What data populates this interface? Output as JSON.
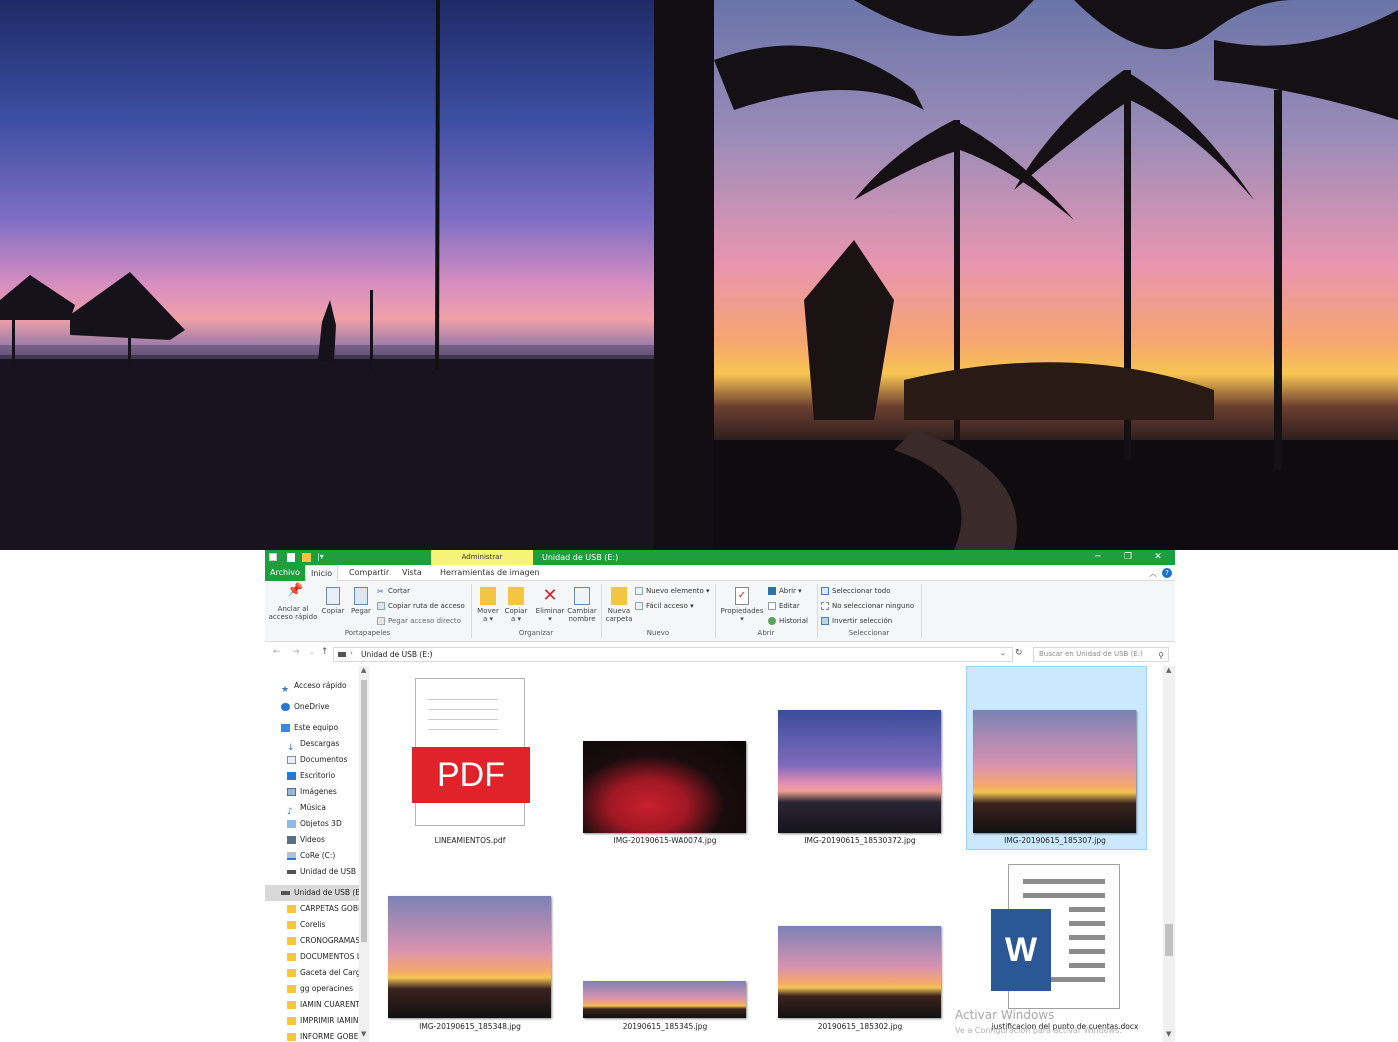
{
  "window": {
    "title": "Unidad de USB (E:)",
    "context_tab": "Administrar"
  },
  "tabs": [
    "Archivo",
    "Inicio",
    "Compartir",
    "Vista",
    "Herramientas de imagen"
  ],
  "ribbon": {
    "portapapeles": {
      "anclar": "Anclar al",
      "anclar2": "acceso rápido",
      "copiar": "Copiar",
      "pegar": "Pegar",
      "cortar": "Cortar",
      "copiar_ruta": "Copiar ruta de acceso",
      "pegar_acceso": "Pegar acceso directo",
      "label": "Portapapeles"
    },
    "organizar": {
      "mover": "Mover",
      "mover2": "a ▾",
      "copiar": "Copiar",
      "copiar2": "a ▾",
      "eliminar": "Eliminar",
      "eliminar2": "▾",
      "cambiar": "Cambiar",
      "cambiar2": "nombre",
      "label": "Organizar"
    },
    "nuevo": {
      "nueva": "Nueva",
      "nueva2": "carpeta",
      "nuevo_elemento": "Nuevo elemento ▾",
      "facil_acceso": "Fácil acceso ▾",
      "label": "Nuevo"
    },
    "abrir": {
      "propiedades": "Propiedades",
      "propiedades2": "▾",
      "abrir": "Abrir ▾",
      "editar": "Editar",
      "historial": "Historial",
      "label": "Abrir"
    },
    "seleccionar": {
      "todo": "Seleccionar todo",
      "ninguno": "No seleccionar ninguno",
      "invertir": "Invertir selección",
      "label": "Seleccionar"
    }
  },
  "address": {
    "path": "Unidad de USB (E:)",
    "search_placeholder": "Buscar en Unidad de USB (E:)"
  },
  "nav": [
    "Acceso rápido",
    "OneDrive",
    "Este equipo",
    "Descargas",
    "Documentos",
    "Escritorio",
    "Imágenes",
    "Música",
    "Objetos 3D",
    "Videos",
    "CoRe (C:)",
    "Unidad de USB (",
    "Unidad de USB (E:",
    "CARPETAS GOBE",
    "Corelis",
    "CRONOGRAMAS",
    "DOCUMENTOS L",
    "Gaceta del Carg",
    "gg operacines",
    "IAMIN CUARENT",
    "IMPRIMIR IAMIN",
    "INFORME GOBEI"
  ],
  "files": [
    "LINEAMIENTOS.pdf",
    "IMG-20190615-WA0074.jpg",
    "IMG-20190615_18530372.jpg",
    "IMG-20190615_185307.jpg",
    "IMG-20190615_185348.jpg",
    "20190615_185345.jpg",
    "20190615_185302.jpg",
    "justificacion del punto de cuentas.docx"
  ],
  "icons": {
    "pdf_text": "PDF",
    "word_letter": "W"
  },
  "watermark": {
    "line1": "Activar Windows",
    "line2": "Ve a Configuración para activar Windows."
  },
  "colors": {
    "titlebar": "#1e9e3e",
    "context_tab": "#f6f27a",
    "pdf_red": "#e0222a",
    "word_blue": "#2b5797",
    "selection": "#cce8ff"
  }
}
